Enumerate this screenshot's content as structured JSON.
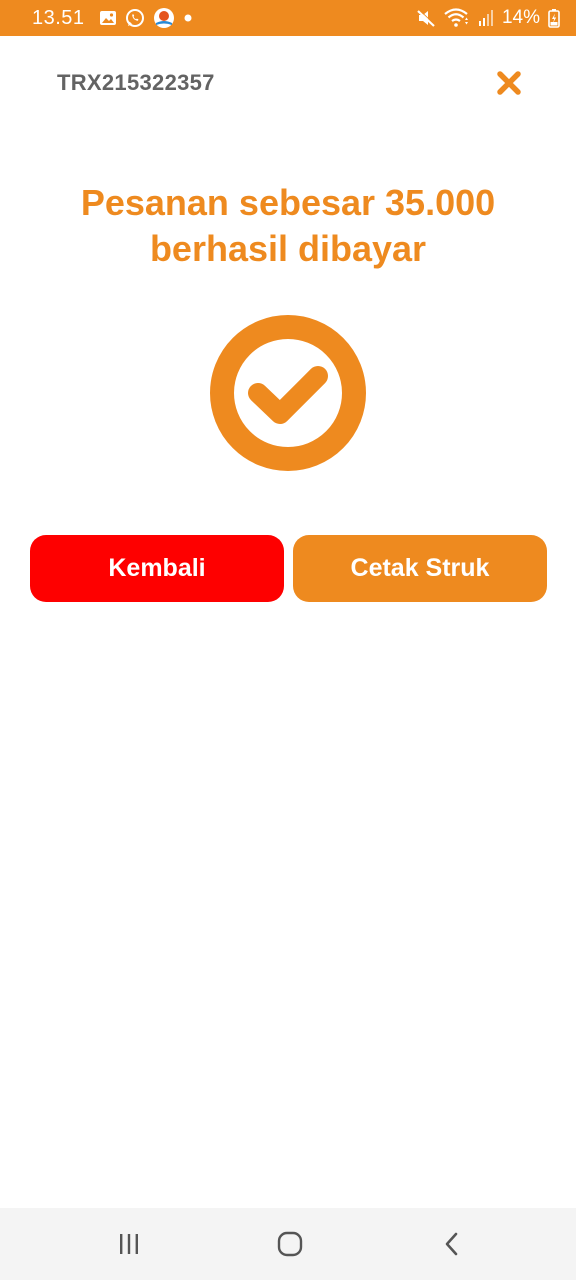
{
  "status_bar": {
    "time": "13.51",
    "battery_text": "14%",
    "icons_left": [
      "gallery-icon",
      "whatsapp-icon",
      "app-notification-icon",
      "dot-icon"
    ],
    "icons_right": [
      "mute-icon",
      "wifi-icon",
      "signal-icon",
      "battery-charging-icon"
    ]
  },
  "header": {
    "transaction_id": "TRX215322357",
    "close_icon": "close-icon"
  },
  "message": {
    "line1": "Pesanan sebesar 35.000",
    "line2": "berhasil dibayar"
  },
  "success_icon": "check-circle-icon",
  "buttons": {
    "back_label": "Kembali",
    "print_label": "Cetak Struk"
  },
  "nav_bar": {
    "icons": [
      "recent-apps-icon",
      "home-icon",
      "back-icon"
    ]
  },
  "colors": {
    "accent": "#ee8a1f",
    "danger": "#fe0000",
    "header_text": "#636363",
    "nav_background": "#f4f4f4"
  }
}
